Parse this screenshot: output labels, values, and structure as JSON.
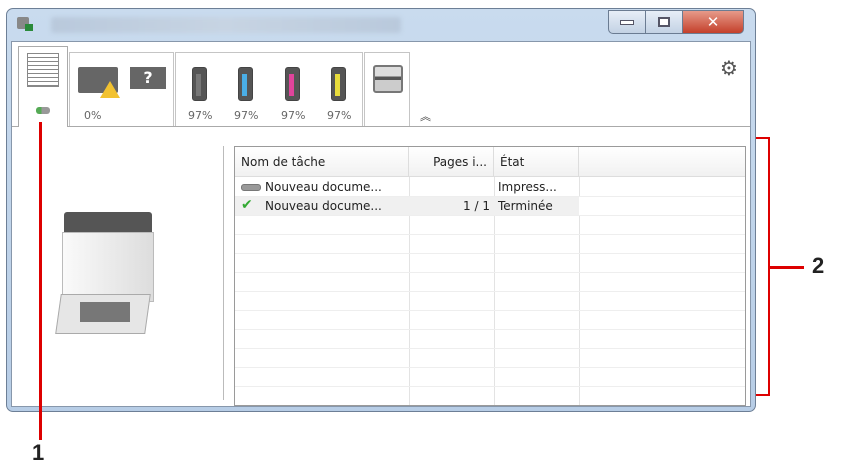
{
  "window": {
    "title_blurred": true
  },
  "tabs": [
    {
      "id": "jobs",
      "icon": "stack-of-paper-icon",
      "status_icon": "printing-status-icon"
    },
    {
      "id": "paper",
      "icons": [
        "paper-tray-warning-icon",
        "paper-tray-unknown-icon"
      ],
      "label": "0%"
    },
    {
      "id": "toner",
      "items": [
        {
          "color": "#555555",
          "name": "black",
          "label": "97%"
        },
        {
          "color": "#4aaee6",
          "name": "cyan",
          "label": "97%"
        },
        {
          "color": "#e0449b",
          "name": "magenta",
          "label": "97%"
        },
        {
          "color": "#e8dc3c",
          "name": "yellow",
          "label": "97%"
        }
      ]
    },
    {
      "id": "device",
      "icon": "multifunction-printer-icon"
    }
  ],
  "collapse_icon": "chevron-up-icon",
  "settings_icon": "gear-icon",
  "table": {
    "columns": [
      "Nom de tâche",
      "Pages i...",
      "État"
    ],
    "rows": [
      {
        "icon": "printing-status-icon",
        "name": "Nouveau docume...",
        "pages": "",
        "state": "Impress..."
      },
      {
        "icon": "checkmark-icon",
        "name": "Nouveau docume...",
        "pages": "1 / 1",
        "state": "Terminée"
      }
    ]
  },
  "callouts": [
    "1",
    "2"
  ]
}
